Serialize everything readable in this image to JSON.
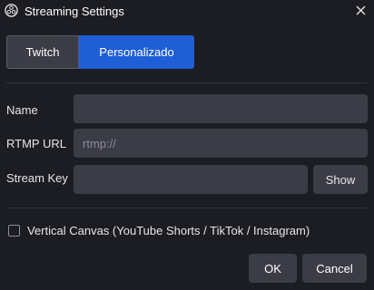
{
  "window": {
    "title": "Streaming Settings"
  },
  "tabs": [
    {
      "label": "Twitch",
      "selected": false
    },
    {
      "label": "Personalizado",
      "selected": true
    }
  ],
  "form": {
    "name": {
      "label": "Name",
      "value": "",
      "placeholder": ""
    },
    "rtmp_url": {
      "label": "RTMP URL",
      "value": "",
      "placeholder": "rtmp://"
    },
    "stream_key": {
      "label": "Stream Key",
      "value": "",
      "placeholder": "",
      "show_label": "Show"
    }
  },
  "vertical_canvas": {
    "label": "Vertical Canvas (YouTube Shorts / TikTok / Instagram)",
    "checked": false
  },
  "buttons": {
    "ok": "OK",
    "cancel": "Cancel"
  },
  "colors": {
    "accent": "#1f5fd6",
    "background": "#1c1d23",
    "field": "#3b3c46"
  }
}
